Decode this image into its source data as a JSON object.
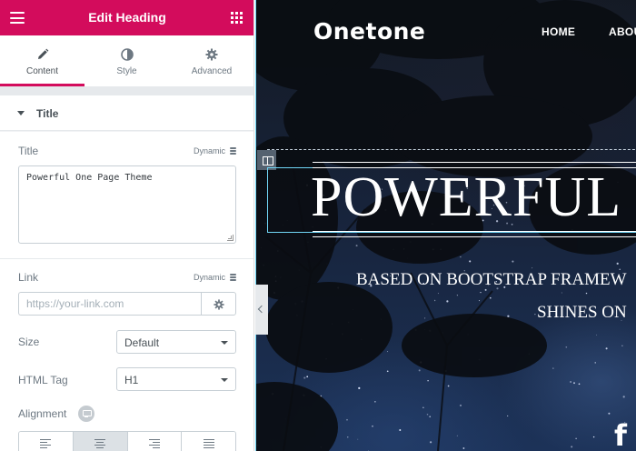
{
  "panel": {
    "title": "Edit Heading",
    "tabs": [
      {
        "label": "Content",
        "icon": "pencil-icon",
        "active": true
      },
      {
        "label": "Style",
        "icon": "half-circle-icon",
        "active": false
      },
      {
        "label": "Advanced",
        "icon": "gear-icon",
        "active": false
      }
    ],
    "section_title": "Title",
    "controls": {
      "title_label": "Title",
      "title_dynamic": "Dynamic",
      "title_value": "Powerful One Page Theme",
      "link_label": "Link",
      "link_dynamic": "Dynamic",
      "link_placeholder": "https://your-link.com",
      "size_label": "Size",
      "size_value": "Default",
      "html_tag_label": "HTML Tag",
      "html_tag_value": "H1",
      "alignment_label": "Alignment",
      "alignment_options": [
        "left",
        "center",
        "right",
        "justify"
      ],
      "alignment_selected": "center"
    },
    "accent_color": "#d30c5c"
  },
  "preview": {
    "logo": "Onetone",
    "nav": [
      "HOME",
      "ABOU"
    ],
    "hero_title": "POWERFUL",
    "hero_subtitle_1": "BASED ON BOOTSTRAP FRAMEW",
    "hero_subtitle_2": "SHINES ON",
    "social_icon": "f"
  }
}
